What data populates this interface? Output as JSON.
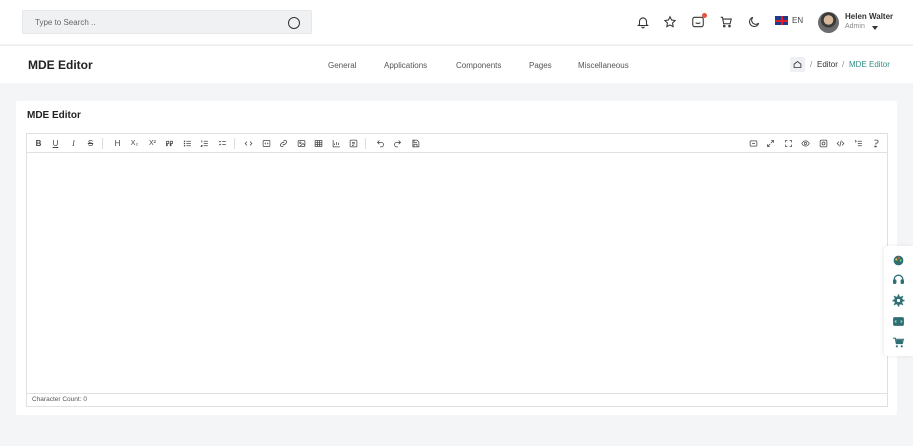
{
  "search": {
    "placeholder": "Type to Search .."
  },
  "header": {
    "language": "EN",
    "user_name": "Helen Walter",
    "user_role": "Admin"
  },
  "navbar": {
    "brand": "MDE Editor",
    "menu": [
      "General",
      "Applications",
      "Components",
      "Pages",
      "Miscellaneous"
    ],
    "breadcrumb": {
      "sep": "/",
      "parent": "Editor",
      "current": "MDE Editor"
    }
  },
  "card": {
    "title": "MDE Editor",
    "status": {
      "label": "Character Count:",
      "count": "0"
    }
  },
  "toolbar_glyphs": {
    "bold": "B",
    "underline": "U",
    "italic": "I",
    "strike": "S",
    "heading": "H",
    "subscript": "X₂",
    "superscript": "X²"
  },
  "colors": {
    "accent": "#2f8f83",
    "badge": "#e5533d",
    "background": "#f4f5f7"
  }
}
